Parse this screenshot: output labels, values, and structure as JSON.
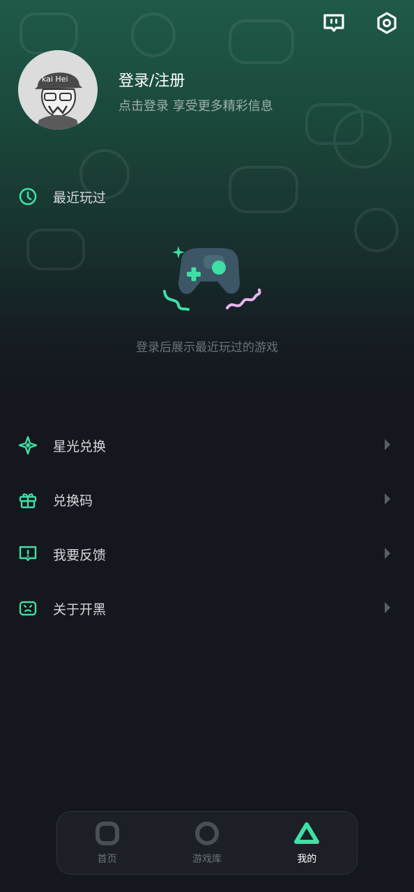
{
  "header": {
    "login_title": "登录/注册",
    "login_subtitle": "点击登录 享受更多精彩信息",
    "avatar_text": "kai Hei",
    "icons": [
      "message-icon",
      "settings-icon"
    ]
  },
  "recent": {
    "label": "最近玩过",
    "empty_text": "登录后展示最近玩过的游戏"
  },
  "menu": {
    "items": [
      {
        "label": "星光兑换",
        "icon": "starlight-icon"
      },
      {
        "label": "兑换码",
        "icon": "gift-icon"
      },
      {
        "label": "我要反馈",
        "icon": "feedback-icon"
      },
      {
        "label": "关于开黑",
        "icon": "about-icon"
      }
    ]
  },
  "tabbar": {
    "tabs": [
      {
        "label": "首页",
        "icon": "home-square-icon",
        "active": false
      },
      {
        "label": "游戏库",
        "icon": "library-circle-icon",
        "active": false
      },
      {
        "label": "我的",
        "icon": "profile-triangle-icon",
        "active": true
      }
    ]
  },
  "colors": {
    "accent": "#3ee0a5",
    "background": "#14171d",
    "header_green": "#1f5a48",
    "muted_text": "#6c7378"
  }
}
